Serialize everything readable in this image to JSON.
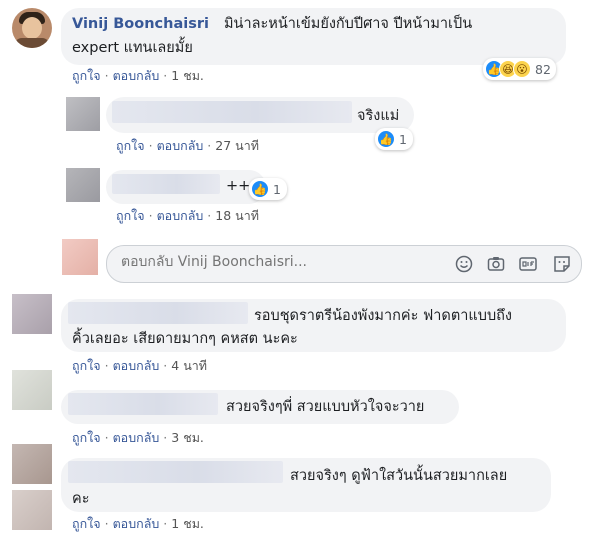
{
  "comment1": {
    "author": "Vinij Boonchaisri",
    "text_line1": "มิน่าละหน้าเข้มยังกับปีศาจ ปีหน้ามาเป็น",
    "text_line2": "expert แทนเลยมั้ย",
    "reaction_count": "82",
    "like_label": "ถูกใจ",
    "reply_label": "ตอบกลับ",
    "time": "1 ชม."
  },
  "reply1": {
    "text": "จริงแม่",
    "reaction_count": "1",
    "like_label": "ถูกใจ",
    "reply_label": "ตอบกลับ",
    "time": "27 นาที"
  },
  "reply2": {
    "text": "++",
    "reaction_count": "1",
    "like_label": "ถูกใจ",
    "reply_label": "ตอบกลับ",
    "time": "18 นาที"
  },
  "reply_box": {
    "placeholder": "ตอบกลับ Vinij Boonchaisri..."
  },
  "comment2": {
    "text_line1": "รอบชุดราตรีน้องพังมากค่ะ ฟาดตาแบบถึง",
    "text_line2": "คิ้วเลยอะ เสียดายมากๆ คหสต นะคะ",
    "like_label": "ถูกใจ",
    "reply_label": "ตอบกลับ",
    "time": "4 นาที"
  },
  "comment3": {
    "text": "สวยจริงๆพี่ สวยแบบหัวใจจะวาย",
    "like_label": "ถูกใจ",
    "reply_label": "ตอบกลับ",
    "time": "3 ชม."
  },
  "comment4": {
    "text_line1": "สวยจริงๆ ดูฟ้าใสวันนั้นสวยมากเลย",
    "text_line2": "คะ",
    "like_label": "ถูกใจ",
    "reply_label": "ตอบกลับ",
    "time": "1 ชม."
  },
  "colors": {
    "link": "#385898",
    "bubble": "#f2f3f5",
    "like_blue": "#1d8cf8"
  },
  "icons": [
    "like-icon",
    "haha-icon",
    "wow-icon",
    "emoji-icon",
    "camera-icon",
    "gif-icon",
    "sticker-icon"
  ]
}
